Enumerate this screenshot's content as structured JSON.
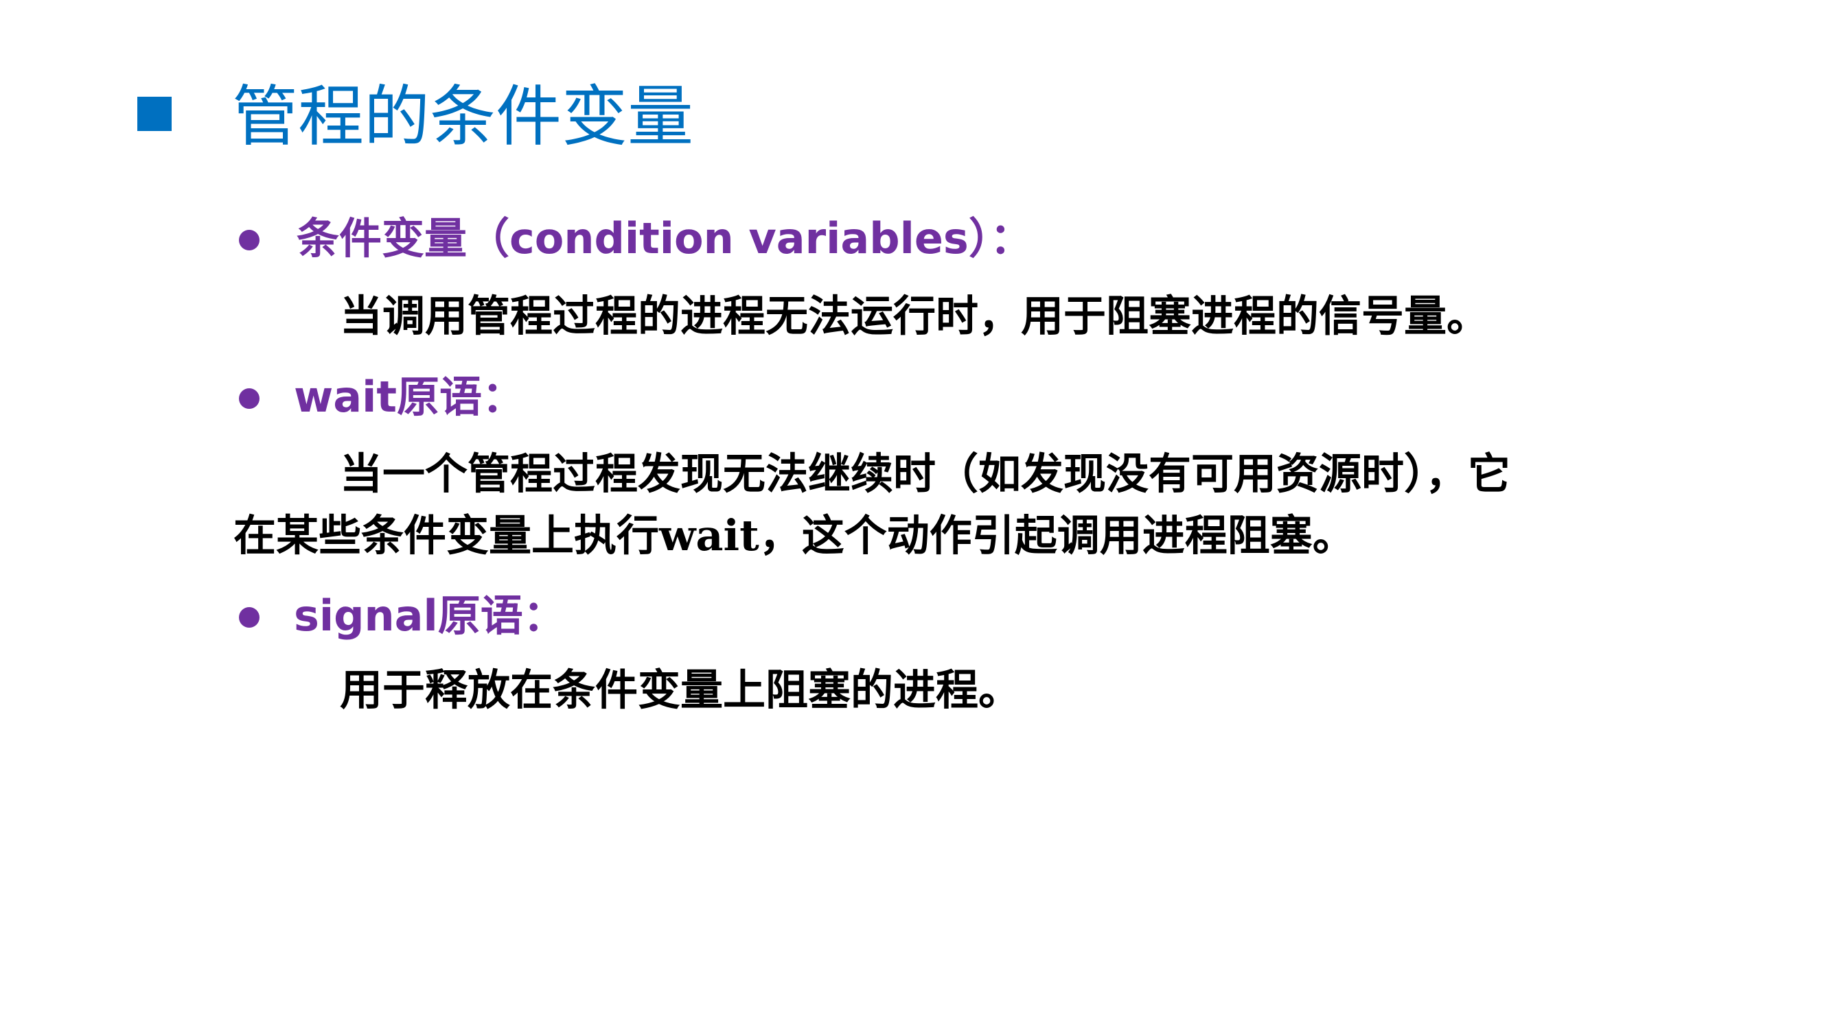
{
  "slide": {
    "title": "管程的条件变量",
    "title_color": "#0070C0",
    "term_color": "#7030A0",
    "body_color": "#000000",
    "bullet_icon": "filled-circle",
    "title_marker_icon": "filled-square",
    "items": [
      {
        "term": "条件变量（condition variables）：",
        "description": "当调用管程过程的进程无法运行时，用于阻塞进程的信号量。"
      },
      {
        "term": "wait原语：",
        "description_line1": "当一个管程过程发现无法继续时（如发现没有可用资源时），它",
        "description_line2": "在某些条件变量上执行wait，这个动作引起调用进程阻塞。"
      },
      {
        "term": "signal原语：",
        "description": "用于释放在条件变量上阻塞的进程。"
      }
    ]
  }
}
